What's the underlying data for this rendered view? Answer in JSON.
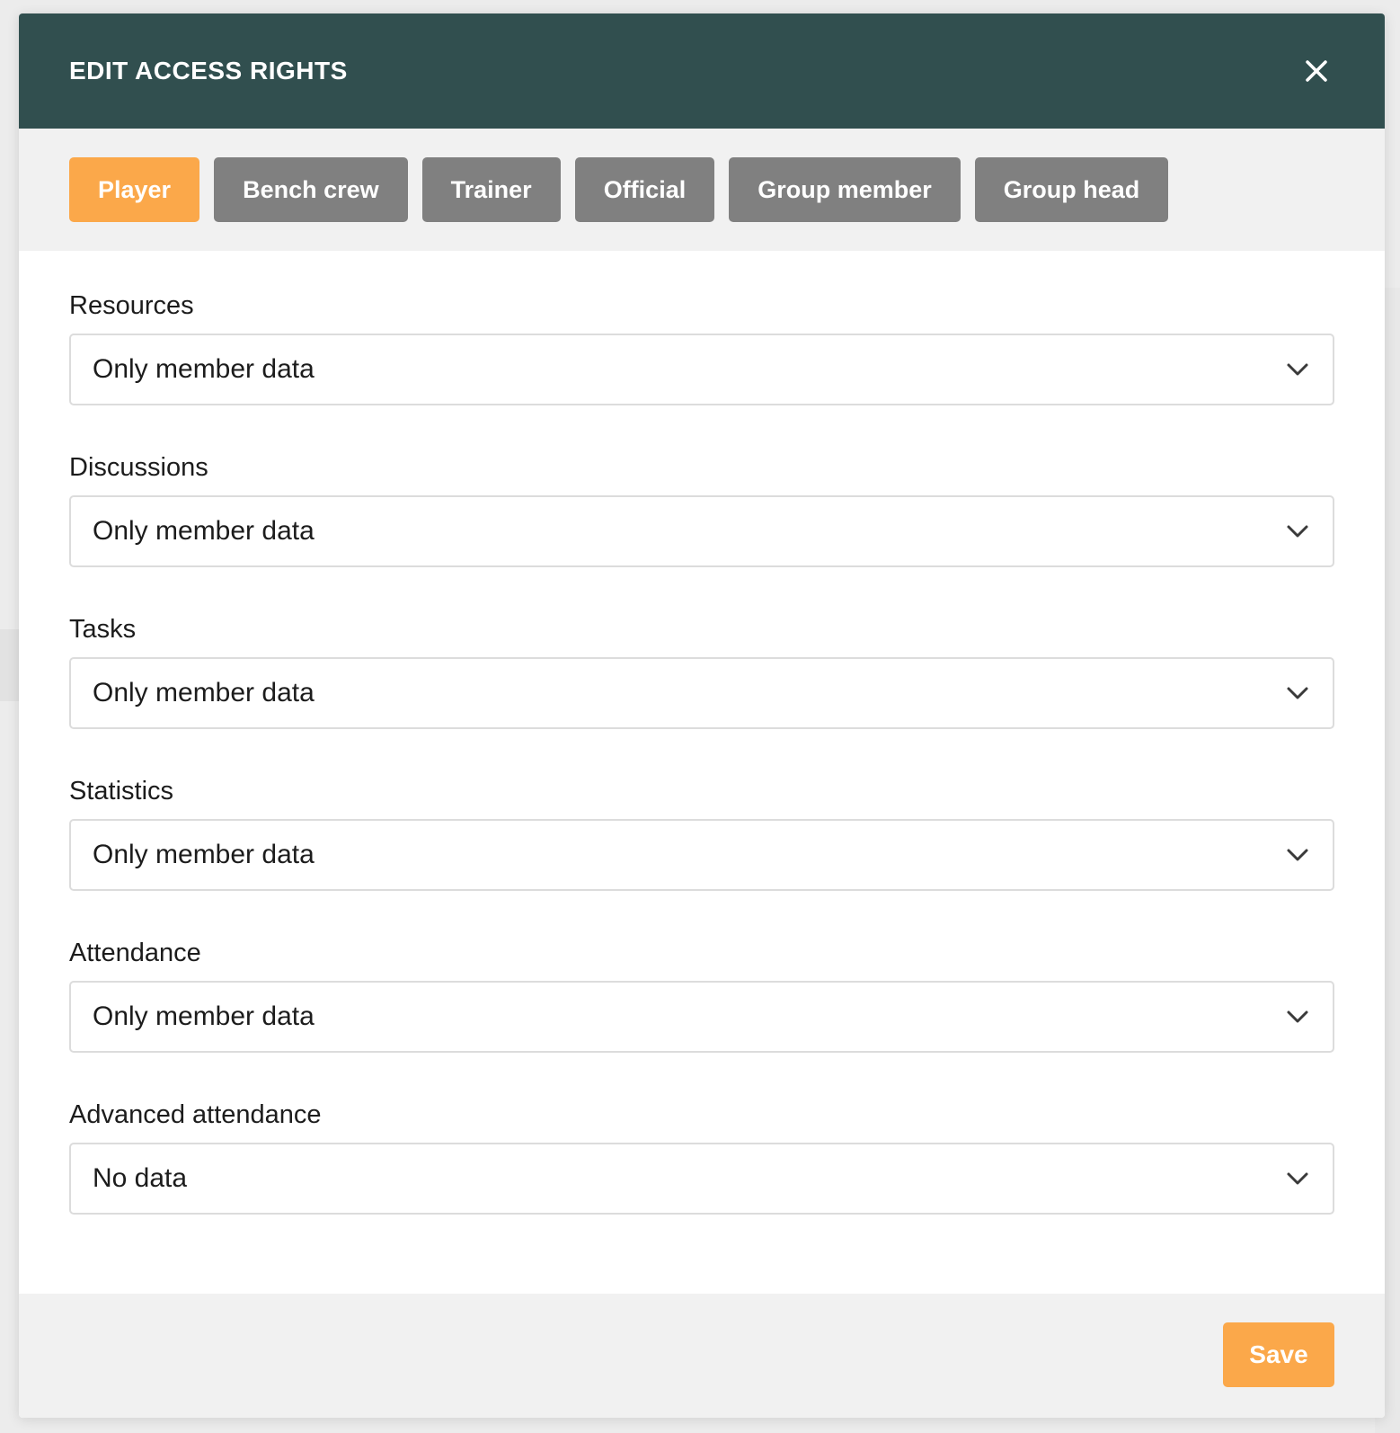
{
  "modal": {
    "title": "EDIT ACCESS RIGHTS",
    "close_icon": "close-icon"
  },
  "tabs": [
    {
      "label": "Player",
      "active": true
    },
    {
      "label": "Bench crew",
      "active": false
    },
    {
      "label": "Trainer",
      "active": false
    },
    {
      "label": "Official",
      "active": false
    },
    {
      "label": "Group member",
      "active": false
    },
    {
      "label": "Group head",
      "active": false
    }
  ],
  "fields": [
    {
      "label": "Resources",
      "value": "Only member data"
    },
    {
      "label": "Discussions",
      "value": "Only member data"
    },
    {
      "label": "Tasks",
      "value": "Only member data"
    },
    {
      "label": "Statistics",
      "value": "Only member data"
    },
    {
      "label": "Attendance",
      "value": "Only member data"
    },
    {
      "label": "Advanced attendance",
      "value": "No data"
    }
  ],
  "footer": {
    "save_label": "Save"
  },
  "colors": {
    "header_bg": "#314f4f",
    "accent": "#fba84a",
    "tab_inactive": "#808080",
    "panel_bg": "#f1f1f1"
  },
  "icons": {
    "close": "close-icon",
    "select_arrow": "chevron-down-icon"
  }
}
